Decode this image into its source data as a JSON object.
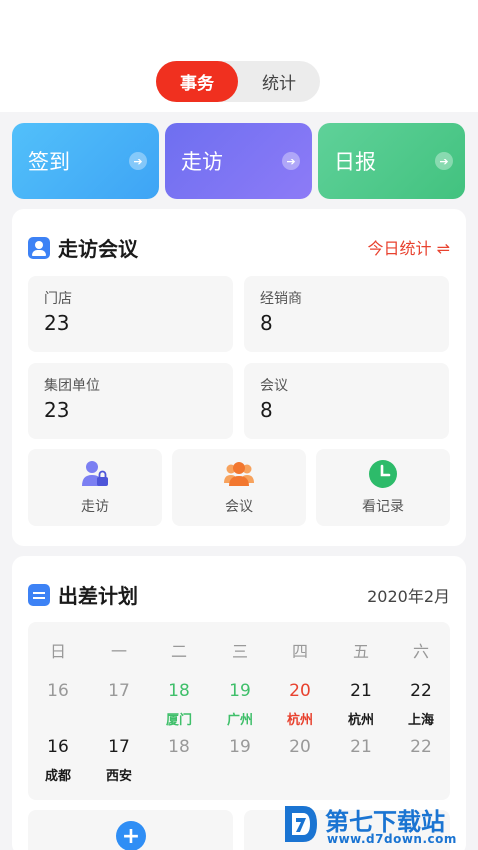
{
  "tabs": {
    "active": "事务",
    "inactive": "统计"
  },
  "tiles": [
    {
      "label": "签到",
      "arrow": "➔"
    },
    {
      "label": "走访",
      "arrow": "➔"
    },
    {
      "label": "日报",
      "arrow": "➔"
    }
  ],
  "visit": {
    "title": "走访会议",
    "stat_link": "今日统计 ⇌",
    "stats": [
      {
        "label": "门店",
        "value": "23"
      },
      {
        "label": "经销商",
        "value": "8"
      },
      {
        "label": "集团单位",
        "value": "23"
      },
      {
        "label": "会议",
        "value": "8"
      }
    ],
    "actions": [
      {
        "label": "走访",
        "icon": "person-lock-icon"
      },
      {
        "label": "会议",
        "icon": "group-icon"
      },
      {
        "label": "看记录",
        "icon": "clock-icon"
      }
    ]
  },
  "trip": {
    "title": "出差计划",
    "month": "2020年2月",
    "weekdays": [
      "日",
      "一",
      "二",
      "三",
      "四",
      "五",
      "六"
    ],
    "week1": [
      {
        "day": "16",
        "city": ""
      },
      {
        "day": "17",
        "city": ""
      },
      {
        "day": "18",
        "city": "厦门"
      },
      {
        "day": "19",
        "city": "广州"
      },
      {
        "day": "20",
        "city": "杭州"
      },
      {
        "day": "21",
        "city": "杭州"
      },
      {
        "day": "22",
        "city": "上海"
      }
    ],
    "week2": [
      {
        "day": "16",
        "city": "成都"
      },
      {
        "day": "17",
        "city": "西安"
      },
      {
        "day": "18",
        "city": ""
      },
      {
        "day": "19",
        "city": ""
      },
      {
        "day": "20",
        "city": ""
      },
      {
        "day": "21",
        "city": ""
      },
      {
        "day": "22",
        "city": ""
      }
    ],
    "add_label": "+"
  },
  "watermark": {
    "text": "第七下载站",
    "sub": "www.d7down.com"
  },
  "colors": {
    "active_tab": "#f0301f",
    "checkin": "#3ea4f5",
    "visit": "#7b75f4",
    "daily": "#4bc788",
    "green_day": "#3fbf6a",
    "red_day": "#e8422f"
  }
}
